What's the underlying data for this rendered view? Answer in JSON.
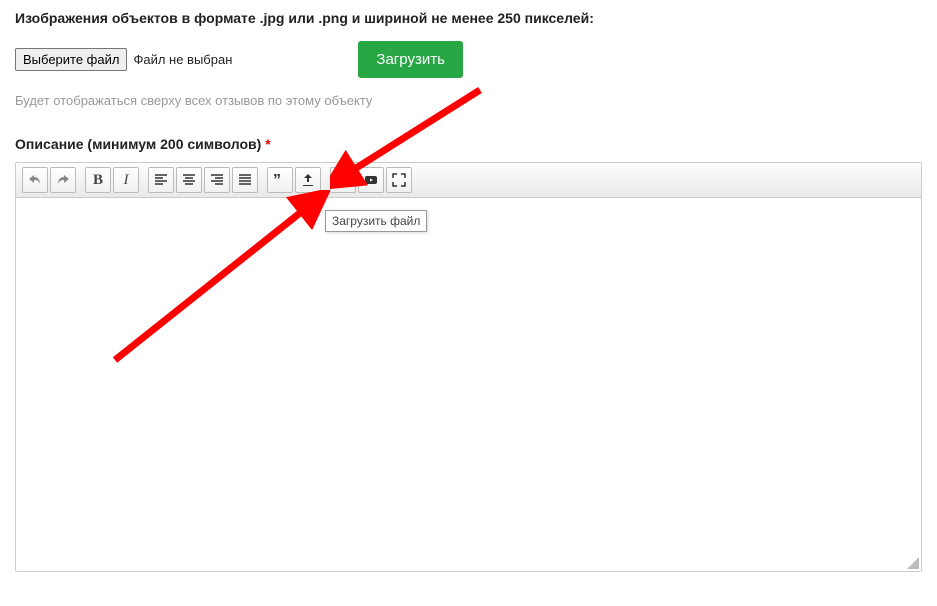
{
  "images_label": "Изображения объектов в формате .jpg или .png и шириной не менее 250 пикселей:",
  "file_button": "Выберите файл",
  "file_status": "Файл не выбран",
  "upload_button": "Загрузить",
  "hint": "Будет отображаться сверху всех отзывов по этому объекту",
  "description_label": "Описание (минимум 200 символов)",
  "required_marker": "*",
  "tooltip": "Загрузить файл",
  "colors": {
    "upload_bg": "#28a745",
    "required": "#e00",
    "arrow": "#ff0000"
  }
}
